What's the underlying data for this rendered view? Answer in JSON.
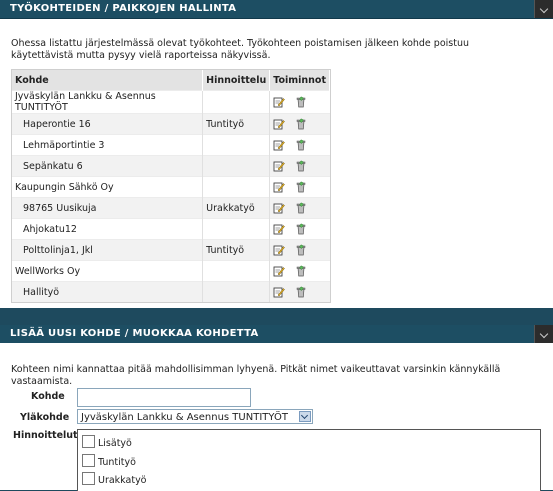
{
  "section1": {
    "title": "TYÖKOHTEIDEN / PAIKKOJEN HALLINTA",
    "description": "Ohessa listattu järjestelmässä olevat työkohteet. Työkohteen poistamisen jälkeen kohde poistuu käytettävistä mutta pysyy vielä raporteissa näkyvissä.",
    "columns": {
      "name": "Kohde",
      "pricing": "Hinnoittelu",
      "actions": "Toiminnot"
    },
    "rows": [
      {
        "name": "Jyväskylän Lankku & Asennus TUNTITYÖT",
        "pricing": "",
        "child": false
      },
      {
        "name": "Haperontie 16",
        "pricing": "Tuntityö",
        "child": true
      },
      {
        "name": "Lehmäportintie 3",
        "pricing": "",
        "child": true
      },
      {
        "name": "Sepänkatu 6",
        "pricing": "",
        "child": true
      },
      {
        "name": "Kaupungin Sähkö Oy",
        "pricing": "",
        "child": false
      },
      {
        "name": "98765 Uusikuja",
        "pricing": "Urakkatyö",
        "child": true
      },
      {
        "name": "Ahjokatu12",
        "pricing": "",
        "child": true
      },
      {
        "name": "Polttolinja1, Jkl",
        "pricing": "Tuntityö",
        "child": true
      },
      {
        "name": "WellWorks Oy",
        "pricing": "",
        "child": false
      },
      {
        "name": "Hallityö",
        "pricing": "",
        "child": true
      }
    ]
  },
  "section2": {
    "title": "LISÄÄ UUSI KOHDE / MUOKKAA KOHDETTA",
    "description": "Kohteen nimi kannattaa pitää mahdollisimman lyhyenä. Pitkät nimet vaikeuttavat varsinkin kännykällä vastaamista.",
    "kohde_label": "Kohde",
    "kohde_value": "",
    "parent_label": "Yläkohde",
    "parent_value": "Jyväskylän Lankku & Asennus TUNTITYÖT",
    "pricing_label": "Hinnoittelut",
    "pricing_options": [
      "Lisätyö",
      "Tuntityö",
      "Urakkatyö"
    ]
  },
  "icons": {
    "edit": "edit-icon",
    "delete": "delete-icon"
  },
  "colors": {
    "header": "#1d4e63",
    "background": "#1e4a5e",
    "table_header": "#e3e3e3"
  }
}
